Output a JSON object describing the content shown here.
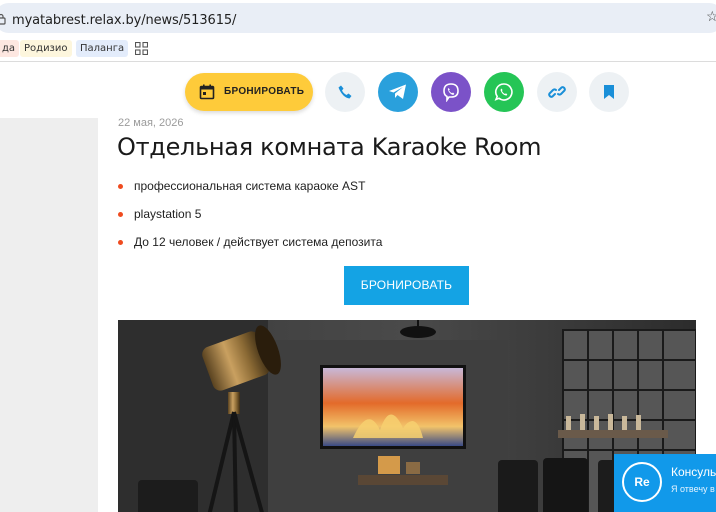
{
  "browser": {
    "url": "myatabrest.relax.by/news/513615/",
    "bookmarks": [
      "да",
      "Родизио",
      "Паланга"
    ]
  },
  "action_bar": {
    "book_label": "БРОНИРОВАТЬ",
    "buttons": [
      "phone-icon",
      "telegram-icon",
      "viber-icon",
      "whatsapp-icon",
      "link-icon",
      "bookmark-icon"
    ],
    "colors": {
      "book": "#fecb3a",
      "telegram": "#2aa0dc",
      "viber": "#7b52c8",
      "whatsapp": "#25c556"
    }
  },
  "article": {
    "date": "22 мая, 2026",
    "title": "Отдельная комната Karaoke Room",
    "features": [
      "профессиональная система караоке AST",
      "playstation 5",
      "До 12 человек / действует система депозита"
    ],
    "cta_label": "БРОНИРОВАТЬ",
    "accent": "#14a3e4",
    "bullet_color": "#ef4b1f"
  },
  "chat_widget": {
    "avatar_text": "Re",
    "title": "Консуль",
    "subtitle": "Я отвечу в"
  }
}
